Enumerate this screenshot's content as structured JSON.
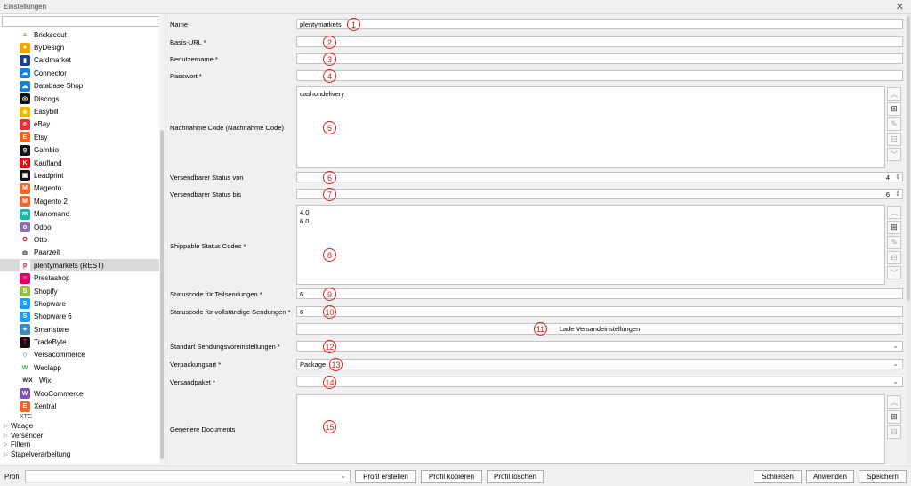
{
  "window": {
    "title": "Einstellungen",
    "close_glyph": "✕"
  },
  "sidebar": {
    "search_placeholder": "",
    "items": [
      {
        "label": "Brickscout",
        "icon": "brickscout-icon",
        "color": "#ffffff",
        "fg": "#e0532a",
        "glyph": "≈"
      },
      {
        "label": "ByDesign",
        "icon": "bydesign-icon",
        "color": "#f5a300",
        "fg": "#ffffff",
        "glyph": "●"
      },
      {
        "label": "Cardmarket",
        "icon": "cardmarket-icon",
        "color": "#1e3e8a",
        "fg": "#ffffff",
        "glyph": "▮"
      },
      {
        "label": "Connector",
        "icon": "connector-icon",
        "color": "#1b7fd1",
        "fg": "#ffffff",
        "glyph": "☁"
      },
      {
        "label": "Database Shop",
        "icon": "database-shop-icon",
        "color": "#1b7fd1",
        "fg": "#ffffff",
        "glyph": "☁"
      },
      {
        "label": "Discogs",
        "icon": "discogs-icon",
        "color": "#111111",
        "fg": "#ffffff",
        "glyph": "◎"
      },
      {
        "label": "Easybill",
        "icon": "easybill-icon",
        "color": "#f5b400",
        "fg": "#ffffff",
        "glyph": "★"
      },
      {
        "label": "eBay",
        "icon": "ebay-icon",
        "color": "#e53238",
        "fg": "#ffffff",
        "glyph": "e"
      },
      {
        "label": "Etsy",
        "icon": "etsy-icon",
        "color": "#f1641e",
        "fg": "#ffffff",
        "glyph": "E"
      },
      {
        "label": "Gambio",
        "icon": "gambio-icon",
        "color": "#111111",
        "fg": "#ffffff",
        "glyph": "g"
      },
      {
        "label": "Kaufland",
        "icon": "kaufland-icon",
        "color": "#e10915",
        "fg": "#ffffff",
        "glyph": "K"
      },
      {
        "label": "Leadprint",
        "icon": "leadprint-icon",
        "color": "#111111",
        "fg": "#ffffff",
        "glyph": "▣"
      },
      {
        "label": "Magento",
        "icon": "magento-icon",
        "color": "#ee672f",
        "fg": "#ffffff",
        "glyph": "M"
      },
      {
        "label": "Magento 2",
        "icon": "magento2-icon",
        "color": "#ee672f",
        "fg": "#ffffff",
        "glyph": "M"
      },
      {
        "label": "Manomano",
        "icon": "manomano-icon",
        "color": "#1fb7ad",
        "fg": "#ffffff",
        "glyph": "m"
      },
      {
        "label": "Odoo",
        "icon": "odoo-icon",
        "color": "#8f6eaa",
        "fg": "#ffffff",
        "glyph": "o"
      },
      {
        "label": "Otto",
        "icon": "otto-icon",
        "color": "#ffffff",
        "fg": "#e0001b",
        "glyph": "O"
      },
      {
        "label": "Paarzeit",
        "icon": "paarzeit-icon",
        "color": "#ffffff",
        "fg": "#555555",
        "glyph": "◍"
      },
      {
        "label": "plentymarkets (REST)",
        "icon": "plentymarkets-icon",
        "color": "#ffffff",
        "fg": "#d7141e",
        "glyph": "p"
      },
      {
        "label": "Prestashop",
        "icon": "prestashop-icon",
        "color": "#df0067",
        "fg": "#ffffff",
        "glyph": "☺"
      },
      {
        "label": "Shopify",
        "icon": "shopify-icon",
        "color": "#95bf47",
        "fg": "#ffffff",
        "glyph": "S"
      },
      {
        "label": "Shopware",
        "icon": "shopware-icon",
        "color": "#189eff",
        "fg": "#ffffff",
        "glyph": "S"
      },
      {
        "label": "Shopware 6",
        "icon": "shopware6-icon",
        "color": "#189eff",
        "fg": "#ffffff",
        "glyph": "S"
      },
      {
        "label": "Smartstore",
        "icon": "smartstore-icon",
        "color": "#3f88c5",
        "fg": "#ffffff",
        "glyph": "✦"
      },
      {
        "label": "TradeByte",
        "icon": "tradebyte-icon",
        "color": "#111111",
        "fg": "#e4003a",
        "glyph": "T"
      },
      {
        "label": "Versacommerce",
        "icon": "versacommerce-icon",
        "color": "#ffffff",
        "fg": "#2b9fd6",
        "glyph": "♢"
      },
      {
        "label": "Weclapp",
        "icon": "weclapp-icon",
        "color": "#ffffff",
        "fg": "#3db44b",
        "glyph": "W"
      },
      {
        "label": "Wix",
        "icon": "wix-icon",
        "color": "#ffffff",
        "fg": "#111111",
        "glyph": "WIX"
      },
      {
        "label": "WooCommerce",
        "icon": "woocommerce-icon",
        "color": "#7f54b3",
        "fg": "#ffffff",
        "glyph": "W"
      },
      {
        "label": "Xentral",
        "icon": "xentral-icon",
        "color": "#ee672f",
        "fg": "#ffffff",
        "glyph": "E"
      }
    ],
    "selected_index": 18,
    "plain_item": "XTC",
    "groups": [
      "Waage",
      "Versender",
      "Filtern",
      "Stapelverarbeitung"
    ]
  },
  "form": {
    "name": {
      "label": "Name",
      "value": "plentymarkets"
    },
    "base_url": {
      "label": "Basis-URL *",
      "value": ""
    },
    "username": {
      "label": "Benutzername *",
      "value": ""
    },
    "password": {
      "label": "Passwort *",
      "value": ""
    },
    "cod_code": {
      "label": "Nachnahme Code (Nachnahme Code)",
      "items": [
        "cashondelivery"
      ]
    },
    "status_from": {
      "label": "Versendbarer Status von",
      "value": "4"
    },
    "status_to": {
      "label": "Versendbarer Status bis",
      "value": "6"
    },
    "shippable_codes": {
      "label": "Shippable Status Codes *",
      "items": [
        "4.0",
        "6.0"
      ]
    },
    "partial_code": {
      "label": "Statuscode für Teilsendungen *",
      "value": "6"
    },
    "complete_code": {
      "label": "Statuscode für vollständige Sendungen *",
      "value": "6"
    },
    "load_button": {
      "label": "Lade Versandeinstellungen"
    },
    "default_shipping": {
      "label": "Standart Sendungsvoreinstellungen *",
      "value": ""
    },
    "packaging": {
      "label": "Verpackungsart *",
      "value": "Package"
    },
    "parcel": {
      "label": "Versandpaket *",
      "value": ""
    },
    "documents": {
      "label": "Generiere Documents",
      "items": []
    }
  },
  "markers": [
    "1",
    "2",
    "3",
    "4",
    "5",
    "6",
    "7",
    "8",
    "9",
    "10",
    "11",
    "12",
    "13",
    "14",
    "15"
  ],
  "footer": {
    "profile_label": "Profil",
    "profile_value": "",
    "create": "Profil erstellen",
    "copy": "Profil kopieren",
    "delete": "Profil löschen",
    "close": "Schließen",
    "apply": "Anwenden",
    "save": "Speichern"
  }
}
